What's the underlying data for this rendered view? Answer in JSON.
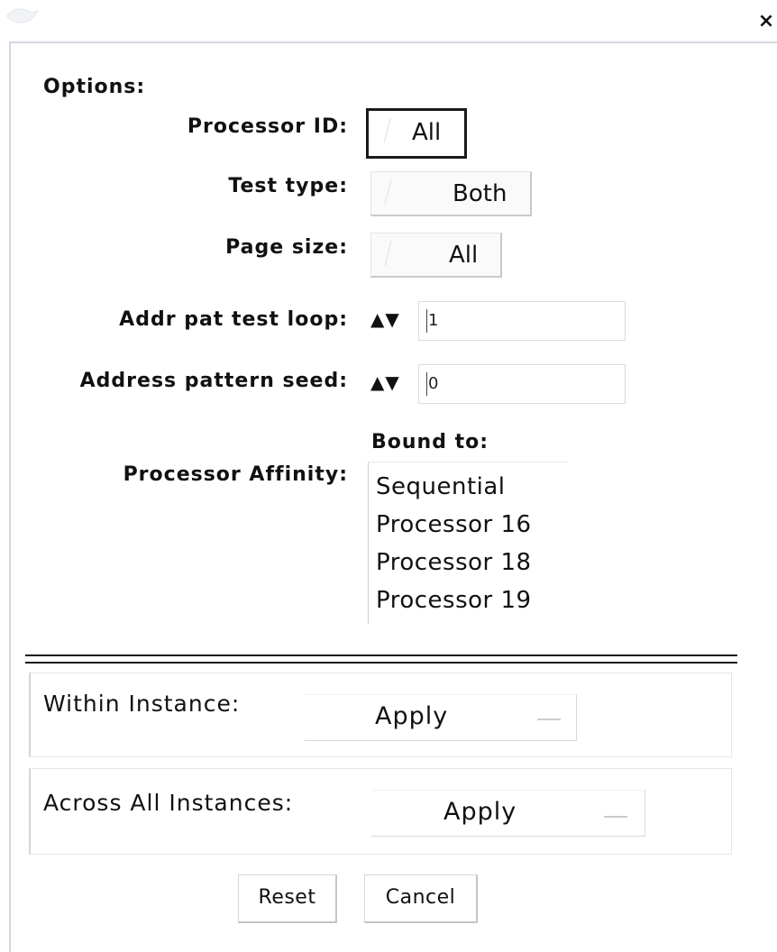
{
  "window": {
    "close_icon": "×"
  },
  "options": {
    "heading": "Options:",
    "processor_id": {
      "label": "Processor ID:",
      "value": "All"
    },
    "test_type": {
      "label": "Test type:",
      "value": "Both"
    },
    "page_size": {
      "label": "Page size:",
      "value": "All"
    },
    "addr_pat_test_loop": {
      "label": "Addr pat test loop:",
      "arrows": "▲▼",
      "value": "1"
    },
    "address_pattern_seed": {
      "label": "Address pattern seed:",
      "arrows": "▲▼",
      "value": "0"
    },
    "processor_affinity": {
      "label": "Processor Affinity:",
      "header": "Bound to:",
      "items": [
        "Sequential",
        "Processor 16",
        "Processor 18",
        "Processor 19"
      ]
    }
  },
  "within_instance": {
    "label": "Within Instance:",
    "button": "Apply"
  },
  "across_instances": {
    "label": "Across All Instances:",
    "button": "Apply"
  },
  "footer": {
    "reset": "Reset",
    "cancel": "Cancel"
  }
}
